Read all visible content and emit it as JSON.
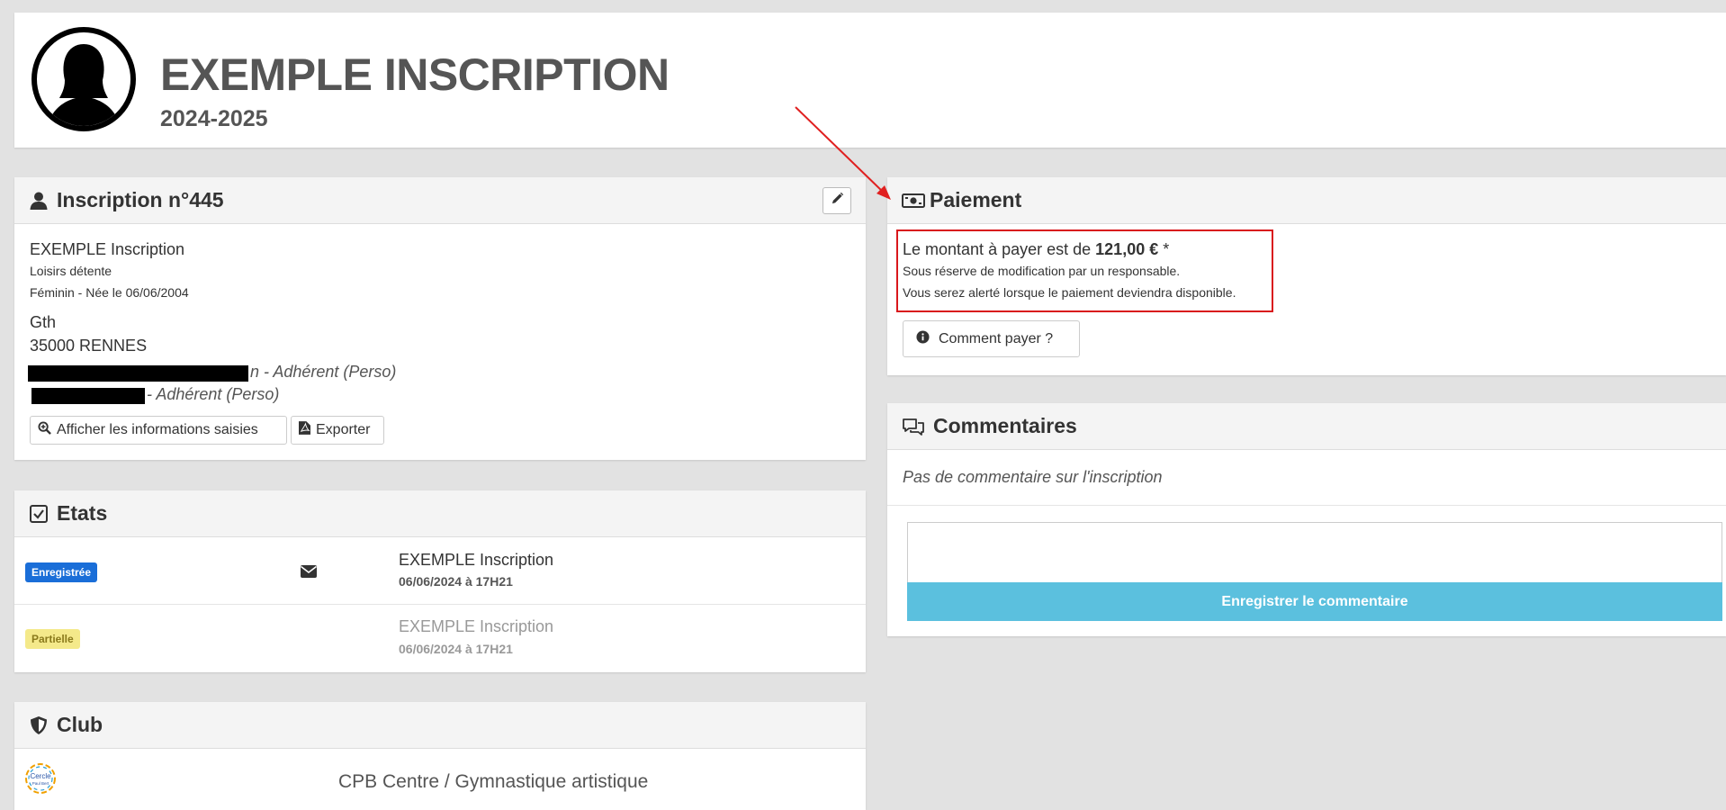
{
  "header": {
    "title": "EXEMPLE INSCRIPTION",
    "season": "2024-2025",
    "avatar_icon": "female-user-avatar-icon"
  },
  "inscription": {
    "title": "Inscription n°445",
    "name": "EXEMPLE Inscription",
    "activity": "Loisirs détente",
    "gender_birth": "Féminin - Née le 06/06/2004",
    "address_line1": "Gth",
    "address_line2": "35000 RENNES",
    "adherent_1_suffix": "n - Adhérent (Perso)",
    "adherent_2_suffix": "- Adhérent (Perso)",
    "show_info_button": "Afficher les informations saisies",
    "export_button": "Exporter"
  },
  "etats": {
    "title": "Etats",
    "rows": [
      {
        "badge": "Enregistrée",
        "badge_color": "#1a6ed8",
        "name": "EXEMPLE Inscription",
        "date": "06/06/2024 à 17H21",
        "icon": "envelope-icon"
      },
      {
        "badge": "Partielle",
        "badge_color": "#f4e98a",
        "name": "EXEMPLE Inscription",
        "date": "06/06/2024 à 17H21",
        "icon": ""
      }
    ]
  },
  "club": {
    "title": "Club",
    "logo_text_1": "Cercle",
    "logo_text_2": "Paul Bert",
    "name": "CPB Centre / Gymnastique artistique"
  },
  "paiement": {
    "title": "Paiement",
    "amount_prefix": "Le montant à payer est de",
    "amount": "121,00 €",
    "amount_suffix": "*",
    "note1": "Sous réserve de modification par un responsable.",
    "note2": "Vous serez alerté lorsque le paiement deviendra disponible.",
    "how_button": "Comment payer ?"
  },
  "commentaires": {
    "title": "Commentaires",
    "empty_text": "Pas de commentaire sur l'inscription",
    "input_value": "",
    "submit_button": "Enregistrer le commentaire"
  },
  "colors": {
    "annotation_red": "#d9181c",
    "submit_blue": "#5bc0de"
  }
}
